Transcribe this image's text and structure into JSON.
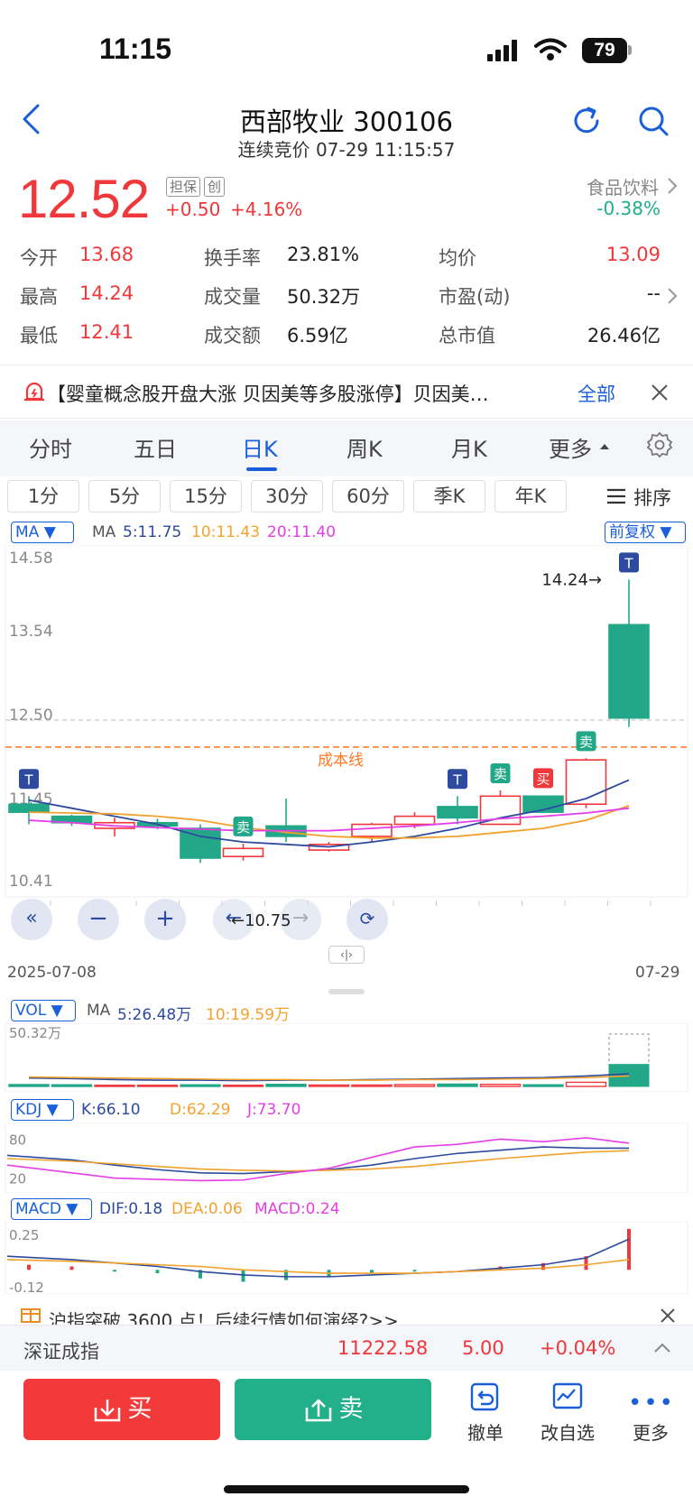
{
  "status": {
    "time": "11:15",
    "battery": "79"
  },
  "header": {
    "title": "西部牧业 300106",
    "subtitle": "连续竞价 07-29 11:15:57"
  },
  "quote": {
    "price": "12.52",
    "tag1": "担保",
    "tag2": "创",
    "change": "+0.50",
    "change_pct": "+4.16%",
    "sector_name": "食品饮料",
    "sector_change": "-0.38%"
  },
  "stats": {
    "open_label": "今开",
    "open": "13.68",
    "high_label": "最高",
    "high": "14.24",
    "low_label": "最低",
    "low": "12.41",
    "turnover_label": "换手率",
    "turnover": "23.81%",
    "volume_label": "成交量",
    "volume": "50.32万",
    "amount_label": "成交额",
    "amount": "6.59亿",
    "avg_label": "均价",
    "avg": "13.09",
    "pe_label": "市盈(动)",
    "pe": "--",
    "mktcap_label": "总市值",
    "mktcap": "26.46亿"
  },
  "news": {
    "text": "【婴童概念股开盘大涨 贝因美等多股涨停】贝因美…",
    "all_label": "全部"
  },
  "tabs": [
    "分时",
    "五日",
    "日K",
    "周K",
    "月K",
    "更多"
  ],
  "subtabs": [
    "1分",
    "5分",
    "15分",
    "30分",
    "60分",
    "季K",
    "年K"
  ],
  "sort_label": "排序",
  "kline": {
    "ma_selector": "MA",
    "ma_label": "MA",
    "ma5": "5:11.75",
    "ma10": "10:11.43",
    "ma20": "20:11.40",
    "adjust_label": "前复权",
    "y_labels": [
      "14.58",
      "13.54",
      "12.50",
      "11.45",
      "10.41"
    ],
    "cost_line_label": "成本线",
    "high_marker": "14.24→",
    "low_marker": "←10.75",
    "date_start": "2025-07-08",
    "date_end": "07-29",
    "colors": {
      "up": "#f0373b",
      "down": "#22a889",
      "ma5": "#2d4a9e",
      "ma10": "#f2a22c",
      "ma20": "#e43ee6",
      "cost": "#ff7a22"
    }
  },
  "chart_data": [
    {
      "type": "candlestick",
      "title": "日K",
      "ylim": [
        10.41,
        14.58
      ],
      "x": [
        "2025-07-08",
        "",
        "",
        "",
        "",
        "",
        "",
        "",
        "",
        "",
        "",
        "",
        "",
        "",
        "07-29"
      ],
      "candles": [
        {
          "open": 11.45,
          "close": 11.35,
          "high": 11.55,
          "low": 11.2
        },
        {
          "open": 11.3,
          "close": 11.22,
          "high": 11.32,
          "low": 11.18
        },
        {
          "open": 11.15,
          "close": 11.22,
          "high": 11.28,
          "low": 11.05
        },
        {
          "open": 11.22,
          "close": 11.18,
          "high": 11.27,
          "low": 11.14
        },
        {
          "open": 11.15,
          "close": 10.78,
          "high": 11.2,
          "low": 10.72
        },
        {
          "open": 10.8,
          "close": 10.9,
          "high": 10.96,
          "low": 10.75
        },
        {
          "open": 11.18,
          "close": 11.05,
          "high": 11.52,
          "low": 10.98
        },
        {
          "open": 10.88,
          "close": 10.95,
          "high": 10.98,
          "low": 10.86
        },
        {
          "open": 11.05,
          "close": 11.2,
          "high": 11.22,
          "low": 10.98
        },
        {
          "open": 11.2,
          "close": 11.3,
          "high": 11.35,
          "low": 11.15
        },
        {
          "open": 11.42,
          "close": 11.28,
          "high": 11.55,
          "low": 11.2
        },
        {
          "open": 11.2,
          "close": 11.55,
          "high": 11.62,
          "low": 11.2
        },
        {
          "open": 11.55,
          "close": 11.35,
          "high": 11.56,
          "low": 11.34
        },
        {
          "open": 11.45,
          "close": 12.0,
          "high": 12.02,
          "low": 11.4
        },
        {
          "open": 13.68,
          "close": 12.52,
          "high": 14.24,
          "low": 12.41
        }
      ],
      "series": [
        {
          "name": "MA5",
          "values": [
            11.5,
            11.4,
            11.3,
            11.2,
            11.05,
            10.98,
            10.95,
            10.92,
            10.98,
            11.05,
            11.15,
            11.28,
            11.38,
            11.52,
            11.75
          ]
        },
        {
          "name": "MA10",
          "values": [
            11.35,
            11.34,
            11.33,
            11.3,
            11.25,
            11.16,
            11.1,
            11.05,
            11.03,
            11.03,
            11.05,
            11.1,
            11.15,
            11.25,
            11.43
          ]
        },
        {
          "name": "MA20",
          "values": [
            11.25,
            11.22,
            11.18,
            11.16,
            11.14,
            11.12,
            11.12,
            11.12,
            11.15,
            11.18,
            11.22,
            11.27,
            11.3,
            11.34,
            11.4
          ]
        }
      ],
      "markers": [
        {
          "index": 0,
          "label": "T"
        },
        {
          "index": 5,
          "label": "卖"
        },
        {
          "index": 10,
          "label": "T"
        },
        {
          "index": 11,
          "label": "卖"
        },
        {
          "index": 12,
          "label": "买"
        },
        {
          "index": 13,
          "label": "卖"
        },
        {
          "index": 14,
          "label": "T"
        }
      ],
      "cost_line": 12.16
    },
    {
      "type": "bar",
      "title": "VOL",
      "ma_label": "MA",
      "ma5": "5:26.48万",
      "ma10": "10:19.59万",
      "y_max_label": "50.32万",
      "ylim": [
        0,
        50.32
      ],
      "values": [
        8,
        7,
        5,
        5,
        7,
        5,
        9,
        6,
        6,
        8,
        10,
        9,
        7,
        18,
        50.32
      ],
      "directions": [
        "down",
        "down",
        "up",
        "up",
        "down",
        "up",
        "down",
        "up",
        "up",
        "up",
        "down",
        "up",
        "down",
        "up",
        "down"
      ]
    },
    {
      "type": "line",
      "title": "KDJ",
      "k": "K:66.10",
      "d": "D:62.29",
      "j": "J:73.70",
      "y_labels": [
        "80",
        "20"
      ],
      "ylim": [
        0,
        100
      ],
      "series": [
        {
          "name": "K",
          "values": [
            55,
            48,
            40,
            33,
            28,
            27,
            30,
            33,
            40,
            50,
            58,
            63,
            68,
            66,
            66.1
          ]
        },
        {
          "name": "D",
          "values": [
            50,
            46,
            42,
            38,
            34,
            32,
            31,
            32,
            34,
            38,
            44,
            50,
            55,
            60,
            62.29
          ]
        },
        {
          "name": "J",
          "values": [
            40,
            28,
            20,
            18,
            16,
            17,
            27,
            35,
            52,
            68,
            72,
            80,
            76,
            82,
            73.7
          ]
        }
      ]
    },
    {
      "type": "bar",
      "title": "MACD",
      "dif": "DIF:0.18",
      "dea": "DEA:0.06",
      "macd": "MACD:0.24",
      "y_labels": [
        "0.25",
        "-0.12"
      ],
      "ylim": [
        -0.12,
        0.25
      ],
      "values": [
        0.03,
        0.02,
        -0.01,
        -0.02,
        -0.05,
        -0.07,
        -0.06,
        -0.04,
        -0.02,
        -0.01,
        0.0,
        0.02,
        0.04,
        0.08,
        0.24
      ],
      "series": [
        {
          "name": "DIF",
          "values": [
            0.08,
            0.06,
            0.04,
            0.02,
            -0.01,
            -0.03,
            -0.04,
            -0.04,
            -0.03,
            -0.02,
            -0.01,
            0.01,
            0.03,
            0.07,
            0.18
          ]
        },
        {
          "name": "DEA",
          "values": [
            0.06,
            0.05,
            0.04,
            0.03,
            0.02,
            0.0,
            -0.01,
            -0.02,
            -0.02,
            -0.02,
            -0.01,
            0.0,
            0.01,
            0.03,
            0.06
          ]
        }
      ]
    }
  ],
  "kdj_selector": "KDJ",
  "vol_selector": "VOL",
  "macd_selector": "MACD",
  "promo": {
    "text": "沪指突破 3600 点！后续行情如何演绎?>>"
  },
  "index_bar": {
    "name": "深证成指",
    "value": "11222.58",
    "change": "5.00",
    "change_pct": "+0.04%"
  },
  "actions": {
    "buy": "买",
    "sell": "卖",
    "cancel": "撤单",
    "edit_watch": "改自选",
    "more": "更多"
  }
}
